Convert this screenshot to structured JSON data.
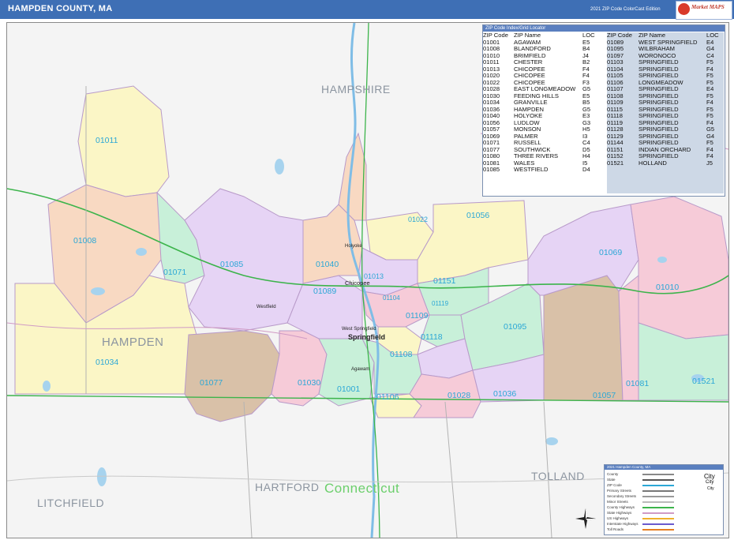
{
  "header": {
    "title": "HAMPDEN COUNTY, MA",
    "edition": "2021 ZIP Code ColorCast Edition",
    "logo_text": "Market MAPS",
    "brand_color": "#3e6fb5"
  },
  "regions": {
    "hampshire": "HAMPSHIRE",
    "hampden": "HAMPDEN",
    "hartford": "HARTFORD",
    "connecticut": "Connecticut",
    "tolland": "TOLLAND",
    "litchfield": "LITCHFIELD"
  },
  "zip_labels": {
    "z01011": "01011",
    "z01008": "01008",
    "z01071": "01071",
    "z01085": "01085",
    "z01034": "01034",
    "z01077": "01077",
    "z01030": "01030",
    "z01001": "01001",
    "z01106": "01106",
    "z01108": "01108",
    "z01028": "01028",
    "z01036": "01036",
    "z01057": "01057",
    "z01081": "01081",
    "z01521": "01521",
    "z01010": "01010",
    "z01069": "01069",
    "z01095": "01095",
    "z01056": "01056",
    "z01022": "01022",
    "z01040": "01040",
    "z01089": "01089",
    "z01013": "01013",
    "z01151": "01151",
    "z01104": "01104",
    "z01119": "01119",
    "z01109": "01109",
    "z01118": "01118"
  },
  "cities": {
    "springfield": "Springfield",
    "chicopee": "Chicopee",
    "holyoke": "Holyoke",
    "west_springfield": "West Springfield",
    "agawam": "Agawam",
    "westfield": "Westfield"
  },
  "index": {
    "title": "ZIP Code Index/Grid Locator",
    "headers": {
      "zip": "ZIP Code",
      "name": "ZIP Name",
      "loc": "LOC"
    },
    "left": [
      [
        "01001",
        "AGAWAM",
        "E5"
      ],
      [
        "01008",
        "BLANDFORD",
        "B4"
      ],
      [
        "01010",
        "BRIMFIELD",
        "J4"
      ],
      [
        "01011",
        "CHESTER",
        "B2"
      ],
      [
        "01013",
        "CHICOPEE",
        "F4"
      ],
      [
        "01020",
        "CHICOPEE",
        "F4"
      ],
      [
        "01022",
        "CHICOPEE",
        "F3"
      ],
      [
        "01028",
        "EAST LONGMEADOW",
        "G5"
      ],
      [
        "01030",
        "FEEDING HILLS",
        "E5"
      ],
      [
        "01034",
        "GRANVILLE",
        "B5"
      ],
      [
        "01036",
        "HAMPDEN",
        "G5"
      ],
      [
        "01040",
        "HOLYOKE",
        "E3"
      ],
      [
        "01056",
        "LUDLOW",
        "G3"
      ],
      [
        "01057",
        "MONSON",
        "H5"
      ],
      [
        "01069",
        "PALMER",
        "I3"
      ],
      [
        "01071",
        "RUSSELL",
        "C4"
      ],
      [
        "01077",
        "SOUTHWICK",
        "D5"
      ],
      [
        "01080",
        "THREE RIVERS",
        "H4"
      ],
      [
        "01081",
        "WALES",
        "I5"
      ],
      [
        "01085",
        "WESTFIELD",
        "D4"
      ]
    ],
    "right": [
      [
        "01089",
        "WEST SPRINGFIELD",
        "E4"
      ],
      [
        "01095",
        "WILBRAHAM",
        "G4"
      ],
      [
        "01097",
        "WORONOCO",
        "C4"
      ],
      [
        "01103",
        "SPRINGFIELD",
        "F5"
      ],
      [
        "01104",
        "SPRINGFIELD",
        "F4"
      ],
      [
        "01105",
        "SPRINGFIELD",
        "F5"
      ],
      [
        "01106",
        "LONGMEADOW",
        "F5"
      ],
      [
        "01107",
        "SPRINGFIELD",
        "E4"
      ],
      [
        "01108",
        "SPRINGFIELD",
        "F5"
      ],
      [
        "01109",
        "SPRINGFIELD",
        "F4"
      ],
      [
        "01115",
        "SPRINGFIELD",
        "F5"
      ],
      [
        "01118",
        "SPRINGFIELD",
        "F5"
      ],
      [
        "01119",
        "SPRINGFIELD",
        "F4"
      ],
      [
        "01128",
        "SPRINGFIELD",
        "G5"
      ],
      [
        "01129",
        "SPRINGFIELD",
        "G4"
      ],
      [
        "01144",
        "SPRINGFIELD",
        "F5"
      ],
      [
        "01151",
        "INDIAN ORCHARD",
        "F4"
      ],
      [
        "01152",
        "SPRINGFIELD",
        "F4"
      ],
      [
        "01521",
        "HOLLAND",
        "J5"
      ]
    ]
  },
  "legend": {
    "title": "2021 Hampden County, MA",
    "rows": [
      "County",
      "State",
      "ZIP Code",
      "Primary Streets",
      "Secondary Streets",
      "Minor Streets",
      "County Highways",
      "State Highways",
      "US Highways",
      "Interstate Highways",
      "Toll Roads"
    ],
    "city_sizes": [
      "City",
      "City",
      "City"
    ]
  },
  "colors": {
    "zip_label": "#2ba7d6",
    "county_line": "#3cb44b",
    "water": "#a7d3ee"
  }
}
